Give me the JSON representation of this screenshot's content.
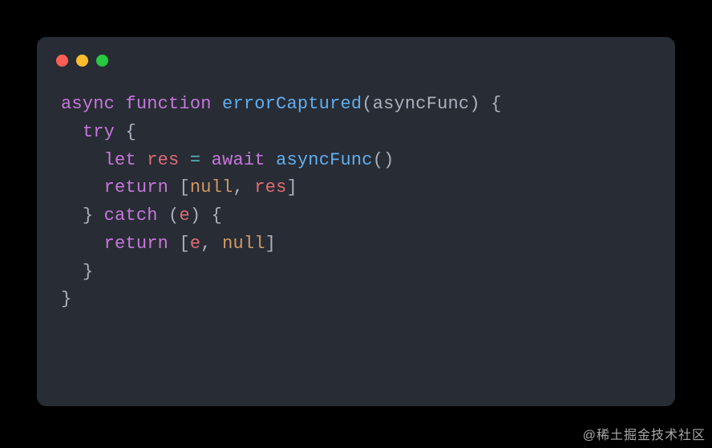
{
  "window": {
    "traffic_lights": [
      "red",
      "yellow",
      "green"
    ]
  },
  "code": {
    "tokens": [
      [
        {
          "t": "async",
          "c": "kw-mod"
        },
        {
          "t": " ",
          "c": "punct"
        },
        {
          "t": "function",
          "c": "kw-decl"
        },
        {
          "t": " ",
          "c": "punct"
        },
        {
          "t": "errorCaptured",
          "c": "fn-name"
        },
        {
          "t": "(",
          "c": "punct"
        },
        {
          "t": "asyncFunc",
          "c": "param"
        },
        {
          "t": ")",
          "c": "punct"
        },
        {
          "t": " ",
          "c": "punct"
        },
        {
          "t": "{",
          "c": "punct"
        }
      ],
      [
        {
          "t": "  ",
          "c": "punct"
        },
        {
          "t": "try",
          "c": "kw-decl"
        },
        {
          "t": " ",
          "c": "punct"
        },
        {
          "t": "{",
          "c": "punct"
        }
      ],
      [
        {
          "t": "    ",
          "c": "punct"
        },
        {
          "t": "let",
          "c": "kw-decl"
        },
        {
          "t": " ",
          "c": "punct"
        },
        {
          "t": "res",
          "c": "ident"
        },
        {
          "t": " ",
          "c": "punct"
        },
        {
          "t": "=",
          "c": "op"
        },
        {
          "t": " ",
          "c": "punct"
        },
        {
          "t": "await",
          "c": "kw-mod"
        },
        {
          "t": " ",
          "c": "punct"
        },
        {
          "t": "asyncFunc",
          "c": "fn-name"
        },
        {
          "t": "()",
          "c": "punct"
        }
      ],
      [
        {
          "t": "    ",
          "c": "punct"
        },
        {
          "t": "return",
          "c": "kw-mod"
        },
        {
          "t": " ",
          "c": "punct"
        },
        {
          "t": "[",
          "c": "punct"
        },
        {
          "t": "null",
          "c": "const"
        },
        {
          "t": ", ",
          "c": "punct"
        },
        {
          "t": "res",
          "c": "ident"
        },
        {
          "t": "]",
          "c": "punct"
        }
      ],
      [
        {
          "t": "  ",
          "c": "punct"
        },
        {
          "t": "}",
          "c": "punct"
        },
        {
          "t": " ",
          "c": "punct"
        },
        {
          "t": "catch",
          "c": "kw-decl"
        },
        {
          "t": " ",
          "c": "punct"
        },
        {
          "t": "(",
          "c": "punct"
        },
        {
          "t": "e",
          "c": "ident"
        },
        {
          "t": ")",
          "c": "punct"
        },
        {
          "t": " ",
          "c": "punct"
        },
        {
          "t": "{",
          "c": "punct"
        }
      ],
      [
        {
          "t": "    ",
          "c": "punct"
        },
        {
          "t": "return",
          "c": "kw-mod"
        },
        {
          "t": " ",
          "c": "punct"
        },
        {
          "t": "[",
          "c": "punct"
        },
        {
          "t": "e",
          "c": "ident"
        },
        {
          "t": ", ",
          "c": "punct"
        },
        {
          "t": "null",
          "c": "const"
        },
        {
          "t": "]",
          "c": "punct"
        }
      ],
      [
        {
          "t": "  ",
          "c": "punct"
        },
        {
          "t": "}",
          "c": "punct"
        }
      ],
      [
        {
          "t": "}",
          "c": "punct"
        }
      ]
    ]
  },
  "watermark": "@稀土掘金技术社区"
}
